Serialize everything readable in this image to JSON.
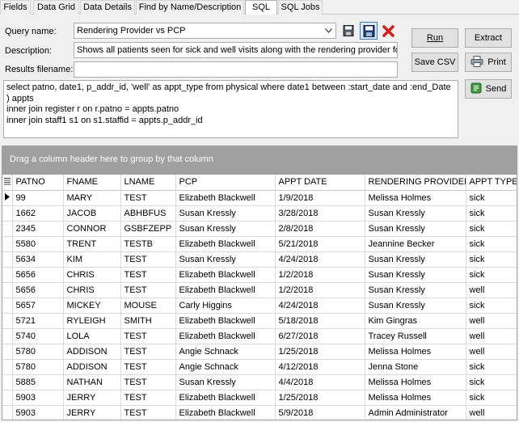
{
  "tabs": [
    {
      "label": "Fields",
      "active": false
    },
    {
      "label": "Data Grid",
      "active": false
    },
    {
      "label": "Data Details",
      "active": false
    },
    {
      "label": "Find by Name/Description",
      "active": false
    },
    {
      "label": "SQL",
      "active": true
    },
    {
      "label": "SQL Jobs",
      "active": false
    }
  ],
  "form": {
    "query_name_label": "Query name:",
    "query_name_value": "Rendering Provider vs PCP",
    "description_label": "Description:",
    "description_value": "Shows all patients seen for sick and well visits along with the rendering provider for",
    "results_filename_label": "Results filename:",
    "results_filename_value": ""
  },
  "buttons": {
    "run": "Run",
    "extract": "Extract",
    "save_csv": "Save CSV",
    "print": "Print",
    "send": "Send"
  },
  "sql_lines": [
    "select patno, date1, p_addr_id, 'well' as appt_type from physical where date1 between :start_date and :end_Date",
    ") appts",
    "inner join register r on r.patno = appts.patno",
    "inner join staff1 s1 on s1.staffid = appts.p_addr_id"
  ],
  "grid": {
    "group_hint": "Drag a column header here to group by that column",
    "columns": [
      "PATNO",
      "FNAME",
      "LNAME",
      "PCP",
      "APPT DATE",
      "RENDERING PROVIDER",
      "APPT TYPE"
    ],
    "rows": [
      [
        "99",
        "MARY",
        "TEST",
        "Elizabeth Blackwell",
        "1/9/2018",
        "Melissa Holmes",
        "sick"
      ],
      [
        "1662",
        "JACOB",
        "ABHBFUS",
        "Susan Kressly",
        "3/28/2018",
        "Susan Kressly",
        "sick"
      ],
      [
        "2345",
        "CONNOR",
        "GSBFZEPP",
        "Susan Kressly",
        "2/8/2018",
        "Susan Kressly",
        "sick"
      ],
      [
        "5580",
        "TRENT",
        "TESTB",
        "Elizabeth Blackwell",
        "5/21/2018",
        "Jeannine Becker",
        "sick"
      ],
      [
        "5634",
        "KIM",
        "TEST",
        "Susan Kressly",
        "4/24/2018",
        "Susan Kressly",
        "sick"
      ],
      [
        "5656",
        "CHRIS",
        "TEST",
        "Elizabeth Blackwell",
        "1/2/2018",
        "Susan Kressly",
        "sick"
      ],
      [
        "5656",
        "CHRIS",
        "TEST",
        "Elizabeth Blackwell",
        "1/2/2018",
        "Susan Kressly",
        "well"
      ],
      [
        "5657",
        "MICKEY",
        "MOUSE",
        "Carly Higgins",
        "4/24/2018",
        "Susan Kressly",
        "sick"
      ],
      [
        "5721",
        "RYLEIGH",
        "SMITH",
        "Elizabeth Blackwell",
        "5/18/2018",
        "Kim  Gingras",
        "well"
      ],
      [
        "5740",
        "LOLA",
        "TEST",
        "Elizabeth Blackwell",
        "6/27/2018",
        "Tracey Russell",
        "well"
      ],
      [
        "5780",
        "ADDISON",
        "TEST",
        "Angie Schnack",
        "1/25/2018",
        "Melissa Holmes",
        "well"
      ],
      [
        "5780",
        "ADDISON",
        "TEST",
        "Angie Schnack",
        "4/12/2018",
        "Jenna Stone",
        "sick"
      ],
      [
        "5885",
        "NATHAN",
        "TEST",
        "Susan Kressly",
        "4/4/2018",
        "Melissa Holmes",
        "sick"
      ],
      [
        "5903",
        "JERRY",
        "TEST",
        "Elizabeth Blackwell",
        "1/25/2018",
        "Melissa Holmes",
        "sick"
      ],
      [
        "5903",
        "JERRY",
        "TEST",
        "Elizabeth Blackwell",
        "5/9/2018",
        "Admin Administrator",
        "well"
      ]
    ],
    "current_row": 0
  },
  "colors": {
    "group_panel_bg": "#a0a0a0",
    "delete_icon": "#d62020",
    "save_icon": "#1e3f74"
  },
  "icons": [
    "save-icon",
    "save-as-icon",
    "delete-icon",
    "printer-icon",
    "send-icon",
    "row-indicator-icon",
    "dropdown-arrow-icon",
    "grid-menu-icon"
  ]
}
